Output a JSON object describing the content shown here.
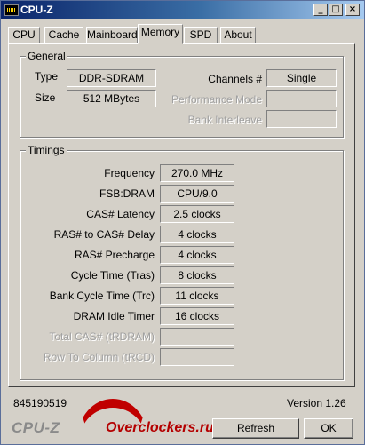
{
  "window": {
    "title": "CPU-Z"
  },
  "tabs": [
    {
      "label": "CPU"
    },
    {
      "label": "Cache"
    },
    {
      "label": "Mainboard"
    },
    {
      "label": "Memory"
    },
    {
      "label": "SPD"
    },
    {
      "label": "About"
    }
  ],
  "active_tab": "Memory",
  "general": {
    "label": "General",
    "type_label": "Type",
    "type_value": "DDR-SDRAM",
    "size_label": "Size",
    "size_value": "512 MBytes",
    "channels_label": "Channels #",
    "channels_value": "Single",
    "perf_mode_label": "Performance Mode",
    "perf_mode_value": "",
    "bank_interleave_label": "Bank Interleave",
    "bank_interleave_value": ""
  },
  "timings": {
    "label": "Timings",
    "rows": [
      {
        "label": "Frequency",
        "value": "270.0 MHz"
      },
      {
        "label": "FSB:DRAM",
        "value": "CPU/9.0"
      },
      {
        "label": "CAS# Latency",
        "value": "2.5 clocks"
      },
      {
        "label": "RAS# to CAS# Delay",
        "value": "4 clocks"
      },
      {
        "label": "RAS# Precharge",
        "value": "4 clocks"
      },
      {
        "label": "Cycle Time (Tras)",
        "value": "8 clocks"
      },
      {
        "label": "Bank Cycle Time (Trc)",
        "value": "11 clocks"
      },
      {
        "label": "DRAM Idle Timer",
        "value": "16 clocks"
      },
      {
        "label": "Total CAS# (tRDRAM)",
        "value": ""
      },
      {
        "label": "Row To Column (tRCD)",
        "value": ""
      }
    ]
  },
  "footer": {
    "id_number": "845190519",
    "version": "Version 1.26",
    "logo_text": "CPU-Z",
    "site_text": "Overclockers.ru",
    "refresh_label": "Refresh",
    "ok_label": "OK"
  }
}
